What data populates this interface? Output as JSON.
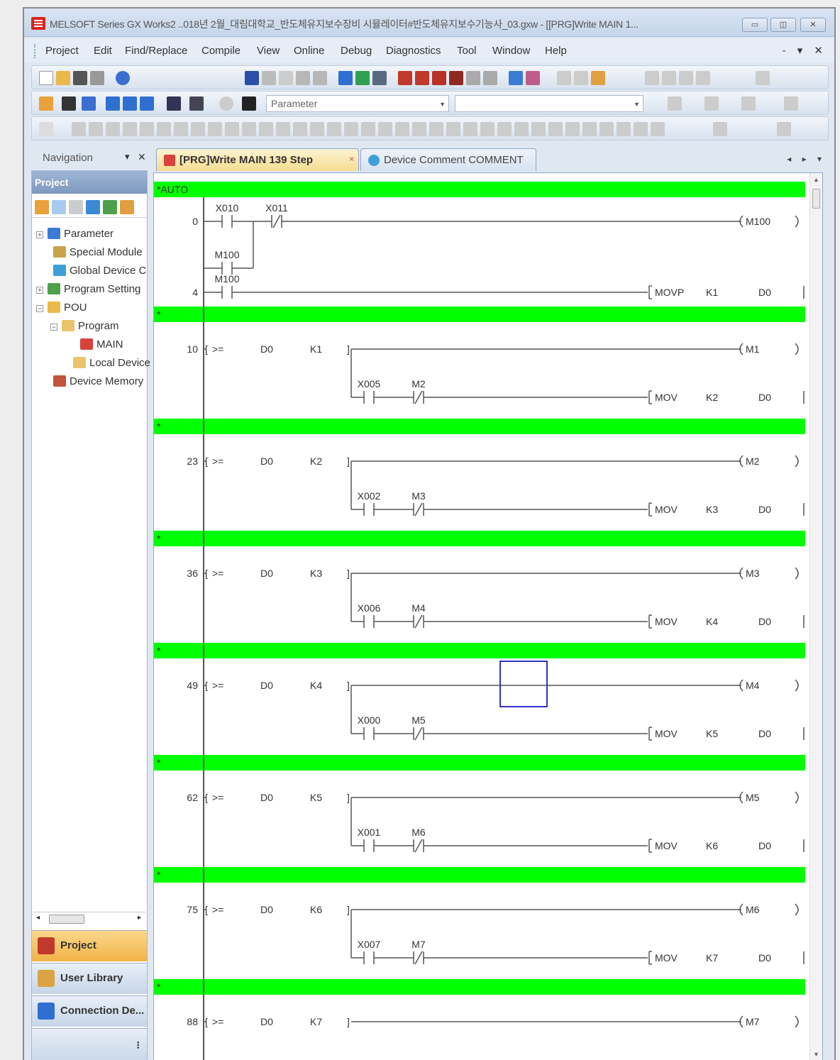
{
  "window": {
    "title": "MELSOFT Series GX Works2 ..018년 2월_대림대학교_반도체유지보수장비 시뮬레이터#반도체유지보수기능사_03.gxw - [[PRG]Write MAIN 1...",
    "controls": [
      "▭",
      "◫",
      "✕"
    ]
  },
  "menu": {
    "items": [
      "Project",
      "Edit",
      "Find/Replace",
      "Compile",
      "View",
      "Online",
      "Debug",
      "Diagnostics",
      "Tool",
      "Window",
      "Help"
    ],
    "mdi_controls": "- ▾ ✕"
  },
  "toolbar": {
    "parameter_combo": "Parameter"
  },
  "navigation": {
    "title": "Navigation",
    "pin": "▾",
    "close": "✕",
    "section_title": "Project",
    "tree": [
      {
        "label": "Parameter",
        "expander": "+",
        "color": "#3a7bd5"
      },
      {
        "label": "Special Module",
        "expander": "",
        "color": "#c9a34a"
      },
      {
        "label": "Global Device C",
        "expander": "",
        "color": "#3fa0d8"
      },
      {
        "label": "Program Setting",
        "expander": "+",
        "color": "#4fa04a"
      },
      {
        "label": "POU",
        "expander": "−",
        "color": "#e9b949"
      },
      {
        "label": "Program",
        "expander": "−",
        "color": "#e9c46a"
      },
      {
        "label": "MAIN",
        "expander": "",
        "color": "#d9413b"
      },
      {
        "label": "Local Device",
        "expander": "",
        "color": "#e9c46a"
      },
      {
        "label": "Device Memory",
        "expander": "",
        "color": "#c0543c"
      }
    ],
    "bottom_buttons": [
      "Project",
      "User Library",
      "Connection De..."
    ],
    "more": "⁝"
  },
  "tabs": {
    "main": "[PRG]Write MAIN 139 Step",
    "main_close": "×",
    "comment": "Device Comment COMMENT",
    "scroll": "◂ ▸ ▾"
  },
  "ladder": {
    "colors": {
      "comment_bg": "#00ff00",
      "line": "#555555",
      "cursor": "#3333cc"
    },
    "sections": [
      {
        "comment": "*AUTO",
        "rungs": [
          {
            "kind": "self_hold",
            "step": "0",
            "contact1": "X010",
            "contact2": "X011",
            "hold": "M100",
            "coil": "M100"
          },
          {
            "kind": "contact_inst",
            "step": "4",
            "contact": "M100",
            "inst": "MOVP",
            "op1": "K1",
            "op2": "D0"
          }
        ]
      },
      {
        "comment": "*",
        "rungs": [
          {
            "kind": "compare",
            "step": "10",
            "op": ">=",
            "dev": "D0",
            "k": "K1",
            "coil": "M1",
            "x": "X005",
            "m": "M2",
            "inst": "MOV",
            "k2": "K2",
            "d": "D0"
          }
        ]
      },
      {
        "comment": "*",
        "rungs": [
          {
            "kind": "compare",
            "step": "23",
            "op": ">=",
            "dev": "D0",
            "k": "K2",
            "coil": "M2",
            "x": "X002",
            "m": "M3",
            "inst": "MOV",
            "k2": "K3",
            "d": "D0"
          }
        ]
      },
      {
        "comment": "*",
        "rungs": [
          {
            "kind": "compare",
            "step": "36",
            "op": ">=",
            "dev": "D0",
            "k": "K3",
            "coil": "M3",
            "x": "X006",
            "m": "M4",
            "inst": "MOV",
            "k2": "K4",
            "d": "D0"
          }
        ]
      },
      {
        "comment": "*",
        "rungs": [
          {
            "kind": "compare",
            "step": "49",
            "op": ">=",
            "dev": "D0",
            "k": "K4",
            "coil": "M4",
            "x": "X000",
            "m": "M5",
            "inst": "MOV",
            "k2": "K5",
            "d": "D0",
            "cursor": true
          }
        ]
      },
      {
        "comment": "*",
        "rungs": [
          {
            "kind": "compare",
            "step": "62",
            "op": ">=",
            "dev": "D0",
            "k": "K5",
            "coil": "M5",
            "x": "X001",
            "m": "M6",
            "inst": "MOV",
            "k2": "K6",
            "d": "D0"
          }
        ]
      },
      {
        "comment": "*",
        "rungs": [
          {
            "kind": "compare",
            "step": "75",
            "op": ">=",
            "dev": "D0",
            "k": "K6",
            "coil": "M6",
            "x": "X007",
            "m": "M7",
            "inst": "MOV",
            "k2": "K7",
            "d": "D0"
          }
        ]
      },
      {
        "comment": "*",
        "rungs": [
          {
            "kind": "compare_partial",
            "step": "88",
            "op": ">=",
            "dev": "D0",
            "k": "K7",
            "coil": "M7"
          }
        ]
      }
    ]
  }
}
